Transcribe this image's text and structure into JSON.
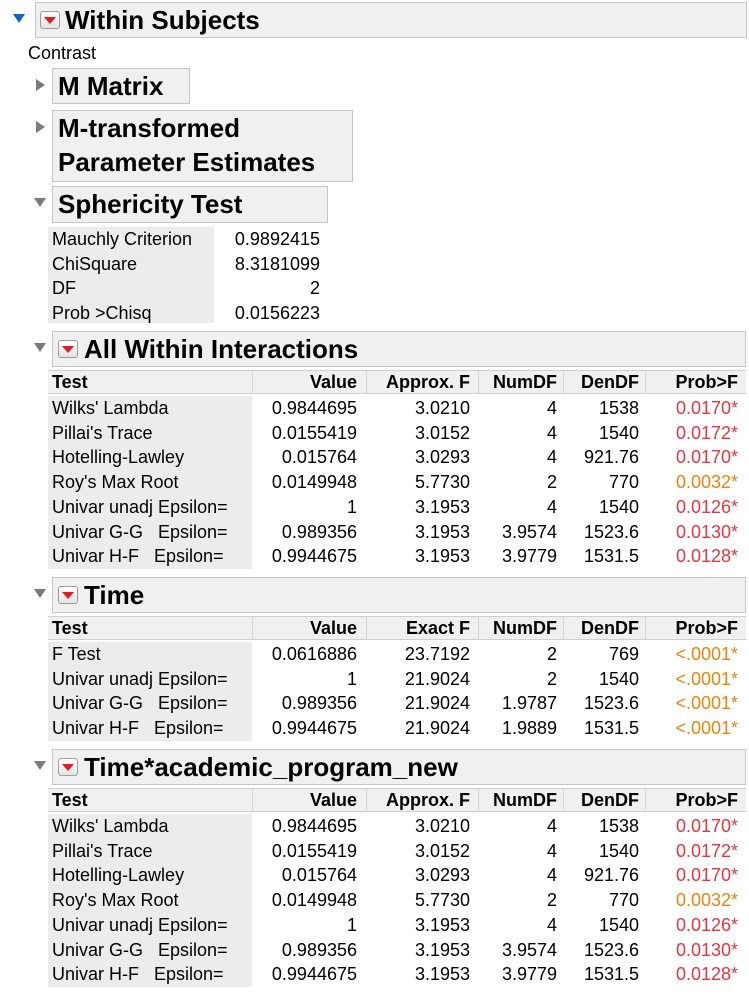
{
  "title": "Within Subjects",
  "contrast_label": "Contrast",
  "m_matrix": "M Matrix",
  "m_transformed_line1": "M-transformed",
  "m_transformed_line2": "Parameter Estimates",
  "sphericity": {
    "title": "Sphericity Test",
    "rows": [
      {
        "label": "Mauchly Criterion",
        "value": "0.9892415"
      },
      {
        "label": "ChiSquare",
        "value": "8.3181099"
      },
      {
        "label": "DF",
        "value": "2"
      },
      {
        "label": "Prob >Chisq",
        "value": "0.0156223"
      }
    ]
  },
  "sections": [
    {
      "title": "All Within Interactions",
      "headers": [
        "Test",
        "Value",
        "Approx. F",
        "NumDF",
        "DenDF",
        "Prob>F"
      ],
      "rows": [
        {
          "test": "Wilks' Lambda",
          "value": "0.9844695",
          "f": "3.0210",
          "numdf": "4",
          "dendf": "1538",
          "prob": "0.0170*",
          "prob_color": "red"
        },
        {
          "test": "Pillai's Trace",
          "value": "0.0155419",
          "f": "3.0152",
          "numdf": "4",
          "dendf": "1540",
          "prob": "0.0172*",
          "prob_color": "red"
        },
        {
          "test": "Hotelling-Lawley",
          "value": "0.015764",
          "f": "3.0293",
          "numdf": "4",
          "dendf": "921.76",
          "prob": "0.0170*",
          "prob_color": "red"
        },
        {
          "test": "Roy's Max Root",
          "value": "0.0149948",
          "f": "5.7730",
          "numdf": "2",
          "dendf": "770",
          "prob": "0.0032*",
          "prob_color": "orange"
        },
        {
          "test": "Univar unadj Epsilon=",
          "value": "1",
          "f": "3.1953",
          "numdf": "4",
          "dendf": "1540",
          "prob": "0.0126*",
          "prob_color": "red"
        },
        {
          "test": "Univar G-G   Epsilon=",
          "value": "0.989356",
          "f": "3.1953",
          "numdf": "3.9574",
          "dendf": "1523.6",
          "prob": "0.0130*",
          "prob_color": "red"
        },
        {
          "test": "Univar H-F   Epsilon=",
          "value": "0.9944675",
          "f": "3.1953",
          "numdf": "3.9779",
          "dendf": "1531.5",
          "prob": "0.0128*",
          "prob_color": "red"
        }
      ]
    },
    {
      "title": "Time",
      "headers": [
        "Test",
        "Value",
        "Exact F",
        "NumDF",
        "DenDF",
        "Prob>F"
      ],
      "rows": [
        {
          "test": "F Test",
          "value": "0.0616886",
          "f": "23.7192",
          "numdf": "2",
          "dendf": "769",
          "prob": "<.0001*",
          "prob_color": "orange"
        },
        {
          "test": "Univar unadj Epsilon=",
          "value": "1",
          "f": "21.9024",
          "numdf": "2",
          "dendf": "1540",
          "prob": "<.0001*",
          "prob_color": "orange"
        },
        {
          "test": "Univar G-G   Epsilon=",
          "value": "0.989356",
          "f": "21.9024",
          "numdf": "1.9787",
          "dendf": "1523.6",
          "prob": "<.0001*",
          "prob_color": "orange"
        },
        {
          "test": "Univar H-F   Epsilon=",
          "value": "0.9944675",
          "f": "21.9024",
          "numdf": "1.9889",
          "dendf": "1531.5",
          "prob": "<.0001*",
          "prob_color": "orange"
        }
      ]
    },
    {
      "title": "Time*academic_program_new",
      "headers": [
        "Test",
        "Value",
        "Approx. F",
        "NumDF",
        "DenDF",
        "Prob>F"
      ],
      "rows": [
        {
          "test": "Wilks' Lambda",
          "value": "0.9844695",
          "f": "3.0210",
          "numdf": "4",
          "dendf": "1538",
          "prob": "0.0170*",
          "prob_color": "red"
        },
        {
          "test": "Pillai's Trace",
          "value": "0.0155419",
          "f": "3.0152",
          "numdf": "4",
          "dendf": "1540",
          "prob": "0.0172*",
          "prob_color": "red"
        },
        {
          "test": "Hotelling-Lawley",
          "value": "0.015764",
          "f": "3.0293",
          "numdf": "4",
          "dendf": "921.76",
          "prob": "0.0170*",
          "prob_color": "red"
        },
        {
          "test": "Roy's Max Root",
          "value": "0.0149948",
          "f": "5.7730",
          "numdf": "2",
          "dendf": "770",
          "prob": "0.0032*",
          "prob_color": "orange"
        },
        {
          "test": "Univar unadj Epsilon=",
          "value": "1",
          "f": "3.1953",
          "numdf": "4",
          "dendf": "1540",
          "prob": "0.0126*",
          "prob_color": "red"
        },
        {
          "test": "Univar G-G   Epsilon=",
          "value": "0.989356",
          "f": "3.1953",
          "numdf": "3.9574",
          "dendf": "1523.6",
          "prob": "0.0130*",
          "prob_color": "red"
        },
        {
          "test": "Univar H-F   Epsilon=",
          "value": "0.9944675",
          "f": "3.1953",
          "numdf": "3.9779",
          "dendf": "1531.5",
          "prob": "0.0128*",
          "prob_color": "red"
        }
      ]
    }
  ],
  "colors": {
    "red": "#e4363f",
    "orange": "#e8850c",
    "disclosure_blue": "#1560c8"
  }
}
